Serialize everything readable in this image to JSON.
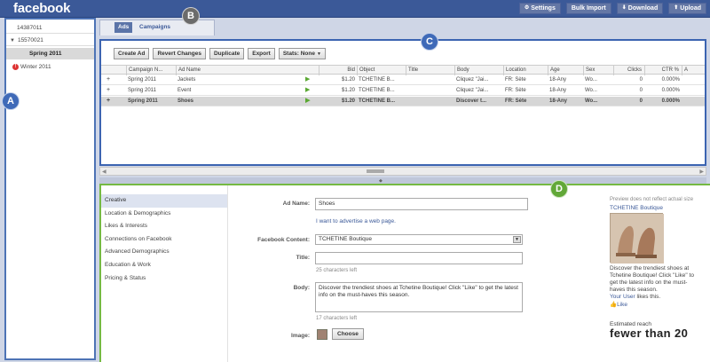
{
  "app": {
    "logo": "facebook",
    "top_buttons": [
      {
        "label": "Settings",
        "icon": "gear-icon"
      },
      {
        "label": "Bulk Import",
        "icon": ""
      },
      {
        "label": "Download",
        "icon": "download-icon"
      },
      {
        "label": "Upload",
        "icon": "upload-icon"
      }
    ]
  },
  "sidebar": {
    "account_1": "14387011",
    "account_2": "15570021",
    "selected_campaign": "Spring 2011",
    "campaign_2": "Winter 2011",
    "campaign_2_badge": "!"
  },
  "tabs": {
    "ads": "Ads",
    "campaigns": "Campaigns"
  },
  "toolbar": {
    "create_ad": "Create Ad",
    "revert_changes": "Revert Changes",
    "duplicate": "Duplicate",
    "export": "Export",
    "stats": "Stats: None"
  },
  "table": {
    "columns": [
      "Campaign N...",
      "Ad Name",
      "Bid",
      "Object",
      "Title",
      "Body",
      "Location",
      "Age",
      "Sex",
      "Clicks",
      "CTR %",
      "A"
    ],
    "rows": [
      {
        "campaign": "Spring 2011",
        "ad_name": "Jackets",
        "bid": "$1.20",
        "object": "TCHETINE B...",
        "title": "",
        "body": "Cliquez \"Jai...",
        "location": "FR: Sète",
        "age": "18-Any",
        "sex": "Wo...",
        "clicks": "0",
        "ctr": "0.000%"
      },
      {
        "campaign": "Spring 2011",
        "ad_name": "Event",
        "bid": "$1.20",
        "object": "TCHETINE B...",
        "title": "",
        "body": "Cliquez \"Jai...",
        "location": "FR: Sète",
        "age": "18-Any",
        "sex": "Wo...",
        "clicks": "0",
        "ctr": "0.000%"
      },
      {
        "campaign": "Spring 2011",
        "ad_name": "Shoes",
        "bid": "$1.20",
        "object": "TCHETINE B...",
        "title": "",
        "body": "Discover t...",
        "location": "FR: Sète",
        "age": "18-Any",
        "sex": "Wo...",
        "clicks": "0",
        "ctr": "0.000%"
      }
    ]
  },
  "detail_nav": [
    "Creative",
    "Location & Demographics",
    "Likes & Interests",
    "Connections on Facebook",
    "Advanced Demographics",
    "Education & Work",
    "Pricing & Status"
  ],
  "form": {
    "ad_name_label": "Ad Name:",
    "ad_name_value": "Shoes",
    "advertise_link": "I want to advertise a web page.",
    "fb_content_label": "Facebook Content:",
    "fb_content_value": "TCHETINE Boutique",
    "title_label": "Title:",
    "title_value": "",
    "title_hint": "25 characters left",
    "body_label": "Body:",
    "body_value": "Discover the trendiest shoes at Tchetine Boutique! Click \"Like\" to get the latest info on the must-haves this season.",
    "body_hint": "17 characters left",
    "image_label": "Image:",
    "choose_button": "Choose"
  },
  "preview": {
    "note": "Preview does not reflect actual size",
    "title": "TCHETINE Boutique",
    "text": "Discover the trendiest shoes at Tchetine Boutique! Click \"Like\" to get the latest info on the must-haves this season.",
    "like_user": "Your User",
    "like_suffix": "likes this.",
    "like_button": "Like",
    "reach_label": "Estimated reach",
    "reach_value": "fewer than 20"
  },
  "callouts": {
    "a": "A",
    "b": "B",
    "c": "C",
    "d": "D"
  },
  "colors": {
    "header": "#3b5998",
    "callout_blue": "#3f6ab8",
    "callout_green": "#62a838",
    "callout_gray": "#6b6b6b"
  }
}
